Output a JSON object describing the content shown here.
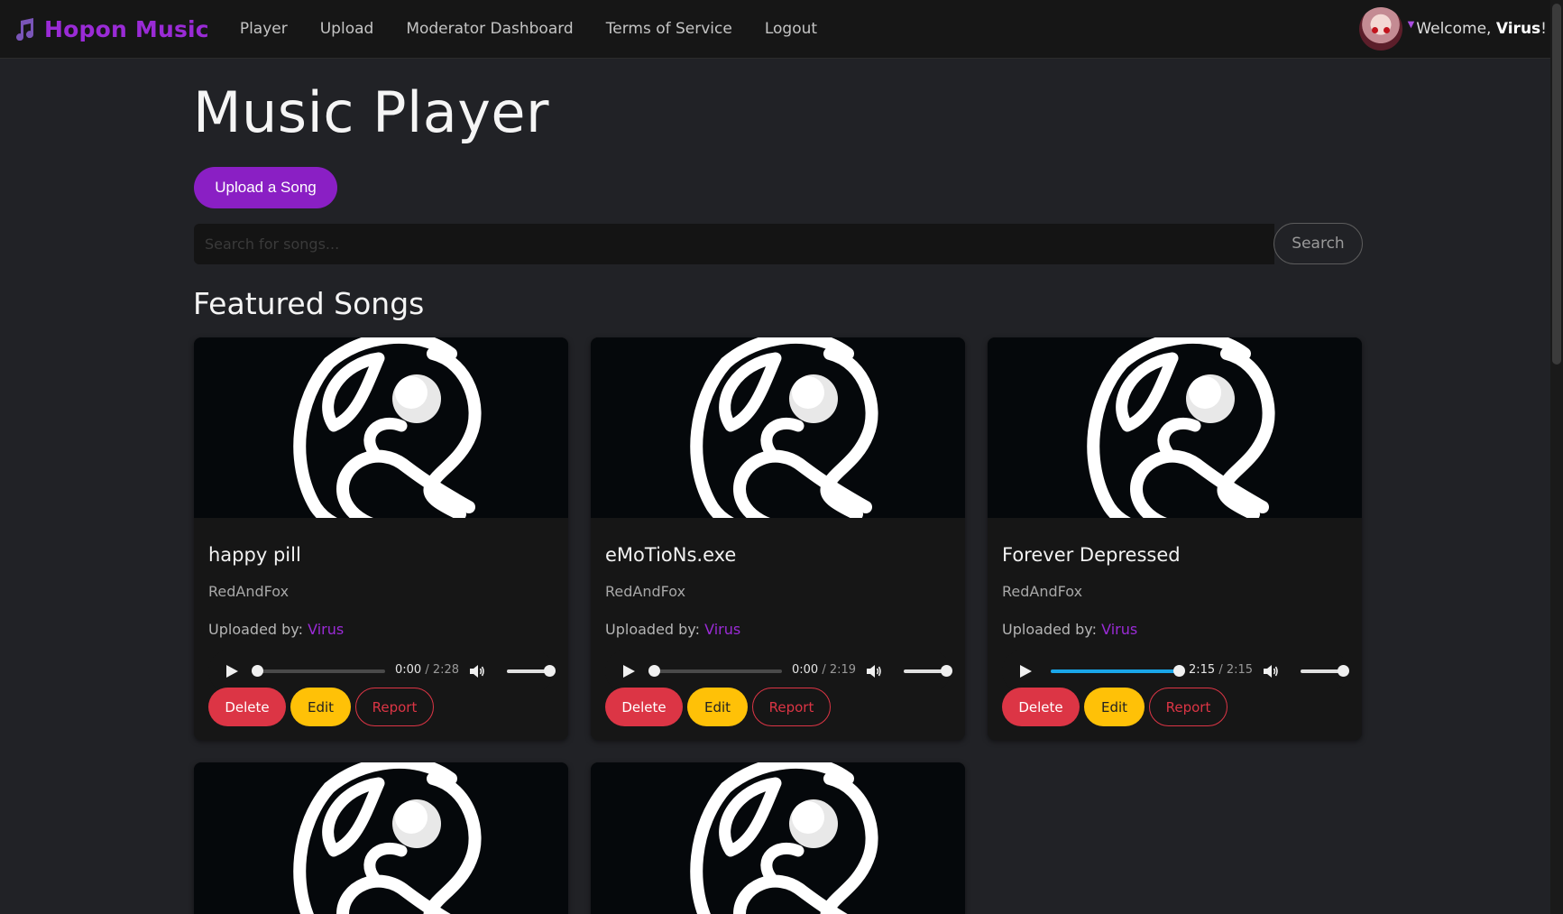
{
  "navbar": {
    "brand": "Hopon Music",
    "brand_icon": "music-note-icon",
    "links": [
      {
        "label": "Player"
      },
      {
        "label": "Upload"
      },
      {
        "label": "Moderator Dashboard"
      },
      {
        "label": "Terms of Service"
      },
      {
        "label": "Logout"
      }
    ],
    "welcome_prefix": "Welcome, ",
    "username": "Virus",
    "welcome_suffix": "!"
  },
  "main": {
    "title": "Music Player",
    "upload_button": "Upload a Song",
    "search_placeholder": "Search for songs...",
    "search_button": "Search",
    "featured_title": "Featured Songs"
  },
  "songs": [
    {
      "title": "happy pill",
      "artist": "RedAndFox",
      "uploaded_label": "Uploaded by: ",
      "uploader": "Virus",
      "current": "0:00",
      "duration": "2:28",
      "progress": 0.0,
      "volume": 1.0,
      "delete": "Delete",
      "edit": "Edit",
      "report": "Report"
    },
    {
      "title": "eMoTioNs.exe",
      "artist": "RedAndFox",
      "uploaded_label": "Uploaded by: ",
      "uploader": "Virus",
      "current": "0:00",
      "duration": "2:19",
      "progress": 0.0,
      "volume": 1.0,
      "delete": "Delete",
      "edit": "Edit",
      "report": "Report"
    },
    {
      "title": "Forever Depressed",
      "artist": "RedAndFox",
      "uploaded_label": "Uploaded by: ",
      "uploader": "Virus",
      "current": "2:15",
      "duration": "2:15",
      "progress": 1.0,
      "volume": 1.0,
      "delete": "Delete",
      "edit": "Edit",
      "report": "Report"
    }
  ],
  "colors": {
    "brand": "#9a2bd6",
    "upload_button": "#8a1fc4",
    "delete": "#dc3545",
    "edit": "#ffc107",
    "progress": "#1aa6e8"
  }
}
